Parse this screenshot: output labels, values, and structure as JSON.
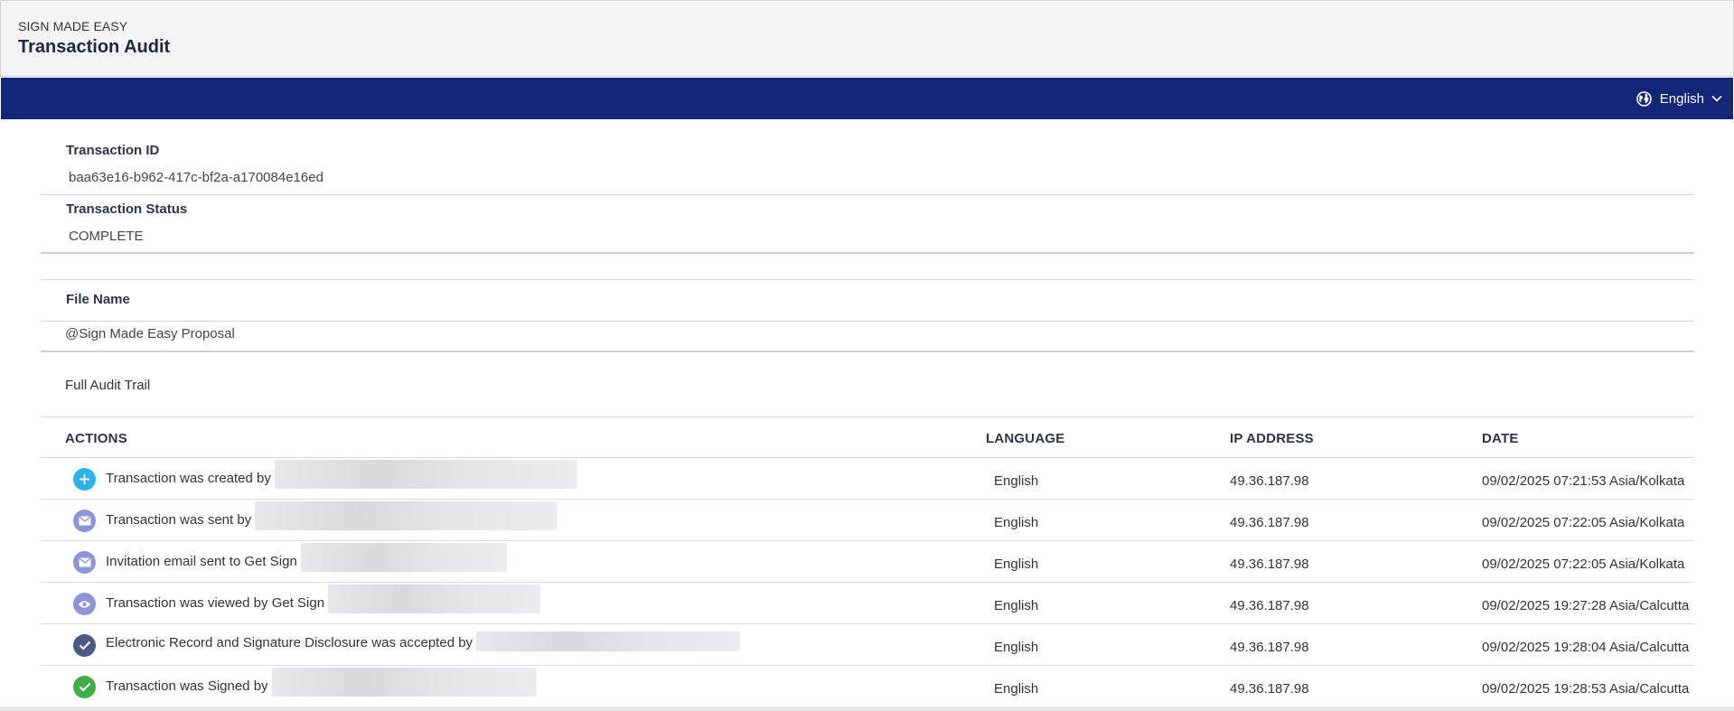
{
  "header": {
    "brand": "SIGN MADE EASY",
    "title": "Transaction Audit"
  },
  "navbar": {
    "language": "English",
    "language_icon": "globe-icon",
    "chevron_icon": "chevron-down-icon",
    "color": "#13277a"
  },
  "transaction": {
    "id_label": "Transaction ID",
    "id_value": "baa63e16-b962-417c-bf2a-a170084e16ed",
    "status_label": "Transaction Status",
    "status_value": "COMPLETE",
    "file_label": "File Name",
    "file_value": "@Sign Made Easy Proposal"
  },
  "audit": {
    "title": "Full Audit Trail",
    "columns": {
      "actions": "ACTIONS",
      "language": "LANGUAGE",
      "ip": "IP ADDRESS",
      "date": "DATE"
    },
    "rows": [
      {
        "icon": "plus-icon",
        "icon_color": "#2bb3e6",
        "action": "Transaction was created by",
        "language": "English",
        "ip": "49.36.187.98",
        "date": "09/02/2025 07:21:53 Asia/Kolkata"
      },
      {
        "icon": "envelope-icon",
        "icon_color": "#8e95d6",
        "action": "Transaction was sent by",
        "language": "English",
        "ip": "49.36.187.98",
        "date": "09/02/2025 07:22:05 Asia/Kolkata"
      },
      {
        "icon": "envelope-icon",
        "icon_color": "#8e95d6",
        "action": "Invitation email sent to Get Sign",
        "language": "English",
        "ip": "49.36.187.98",
        "date": "09/02/2025 07:22:05 Asia/Kolkata"
      },
      {
        "icon": "eye-icon",
        "icon_color": "#8e95d6",
        "action": "Transaction was viewed by Get Sign",
        "language": "English",
        "ip": "49.36.187.98",
        "date": "09/02/2025 19:27:28 Asia/Calcutta"
      },
      {
        "icon": "check-icon",
        "icon_color": "#4a5a80",
        "action": "Electronic Record and Signature Disclosure was accepted by",
        "language": "English",
        "ip": "49.36.187.98",
        "date": "09/02/2025 19:28:04 Asia/Calcutta"
      },
      {
        "icon": "check-circle-icon",
        "icon_color": "#3fae49",
        "action": "Transaction was Signed by",
        "language": "English",
        "ip": "49.36.187.98",
        "date": "09/02/2025 19:28:53 Asia/Calcutta"
      }
    ]
  }
}
